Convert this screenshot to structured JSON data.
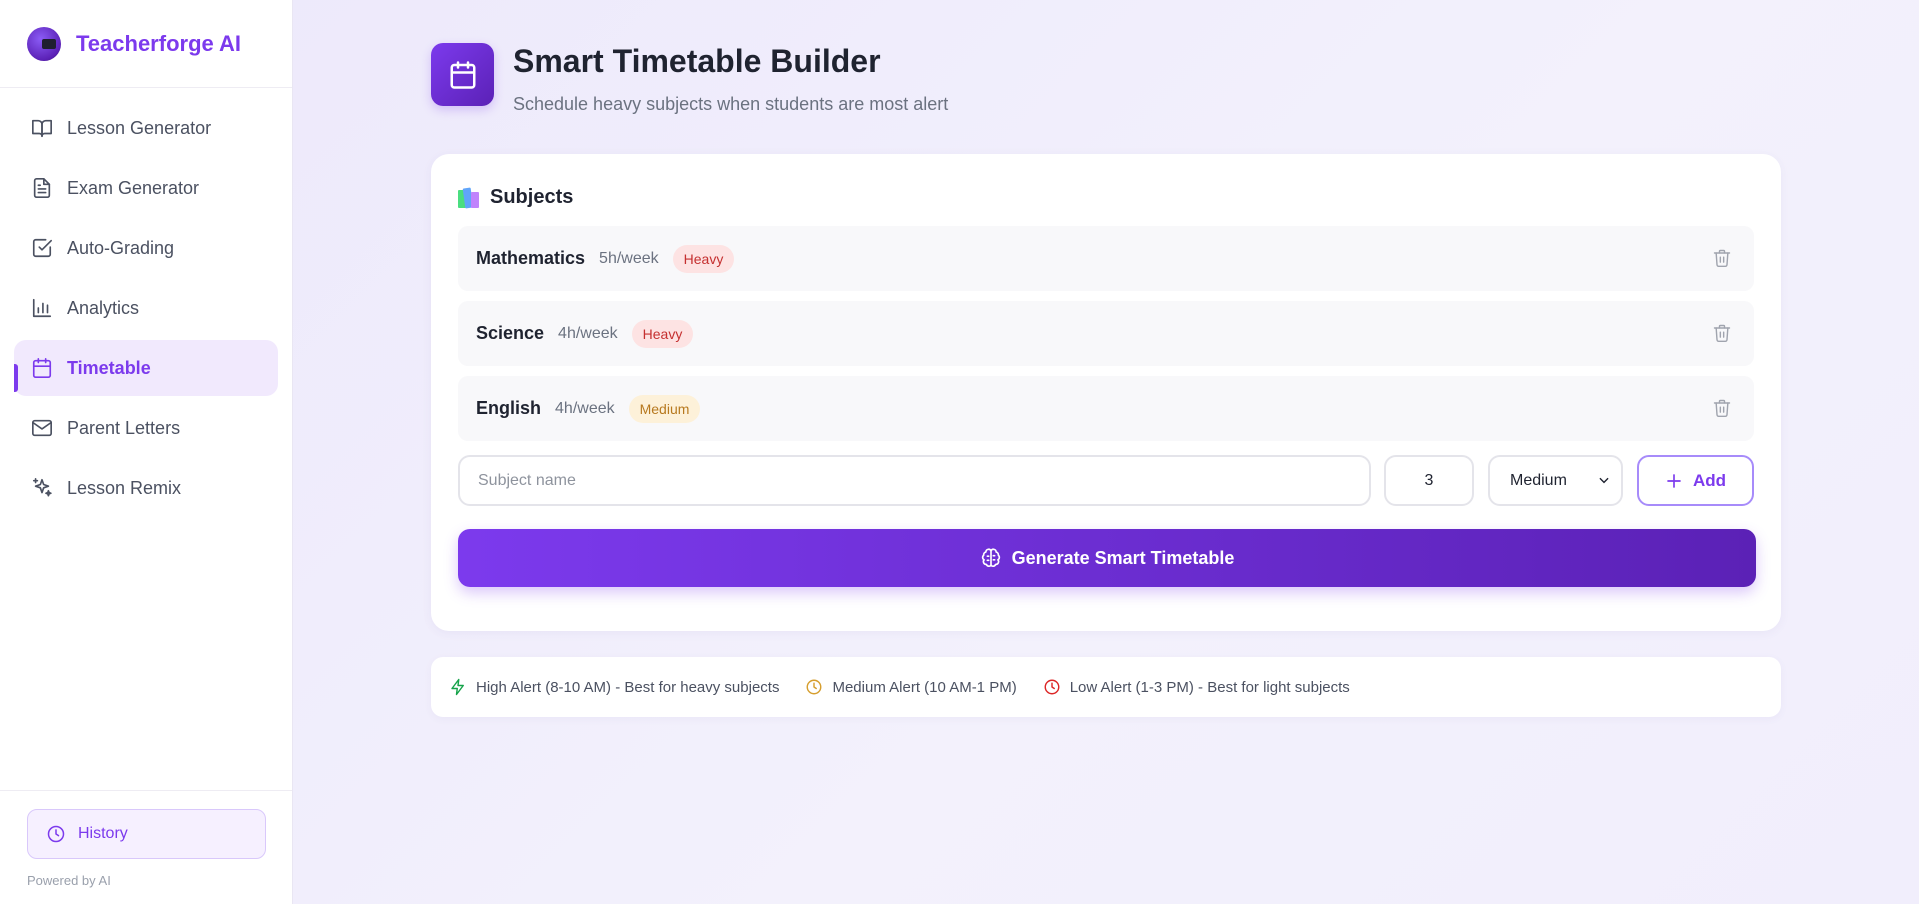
{
  "app": {
    "name": "Teacherforge AI"
  },
  "sidebar": {
    "items": [
      {
        "label": "Lesson Generator",
        "icon": "book-open-icon"
      },
      {
        "label": "Exam Generator",
        "icon": "document-icon"
      },
      {
        "label": "Auto-Grading",
        "icon": "checkbox-icon"
      },
      {
        "label": "Analytics",
        "icon": "bar-chart-icon"
      },
      {
        "label": "Timetable",
        "icon": "calendar-icon",
        "active": true
      },
      {
        "label": "Parent Letters",
        "icon": "mail-icon"
      },
      {
        "label": "Lesson Remix",
        "icon": "sparkles-icon"
      }
    ],
    "history_label": "History",
    "powered_by": "Powered by AI"
  },
  "page": {
    "title": "Smart Timetable Builder",
    "subtitle": "Schedule heavy subjects when students are most alert"
  },
  "subjects_card": {
    "title": "Subjects",
    "subjects": [
      {
        "name": "Mathematics",
        "hours": "5h/week",
        "intensity": "Heavy"
      },
      {
        "name": "Science",
        "hours": "4h/week",
        "intensity": "Heavy"
      },
      {
        "name": "English",
        "hours": "4h/week",
        "intensity": "Medium"
      }
    ],
    "form": {
      "name_placeholder": "Subject name",
      "name_value": "",
      "hours_value": "3",
      "intensity_selected": "Medium",
      "add_label": "Add"
    },
    "generate_label": "Generate Smart Timetable"
  },
  "legend": {
    "high": "High Alert (8-10 AM) - Best for heavy subjects",
    "medium": "Medium Alert (10 AM-1 PM)",
    "low": "Low Alert (1-3 PM) - Best for light subjects"
  },
  "colors": {
    "accent": "#7c3aed",
    "heavy_badge_bg": "#fde3e3",
    "heavy_badge_text": "#c53030",
    "medium_badge_bg": "#fdf1d9",
    "medium_badge_text": "#b7791f",
    "high_alert": "#16a34a",
    "medium_alert": "#d69e2e",
    "low_alert": "#dc2626"
  }
}
